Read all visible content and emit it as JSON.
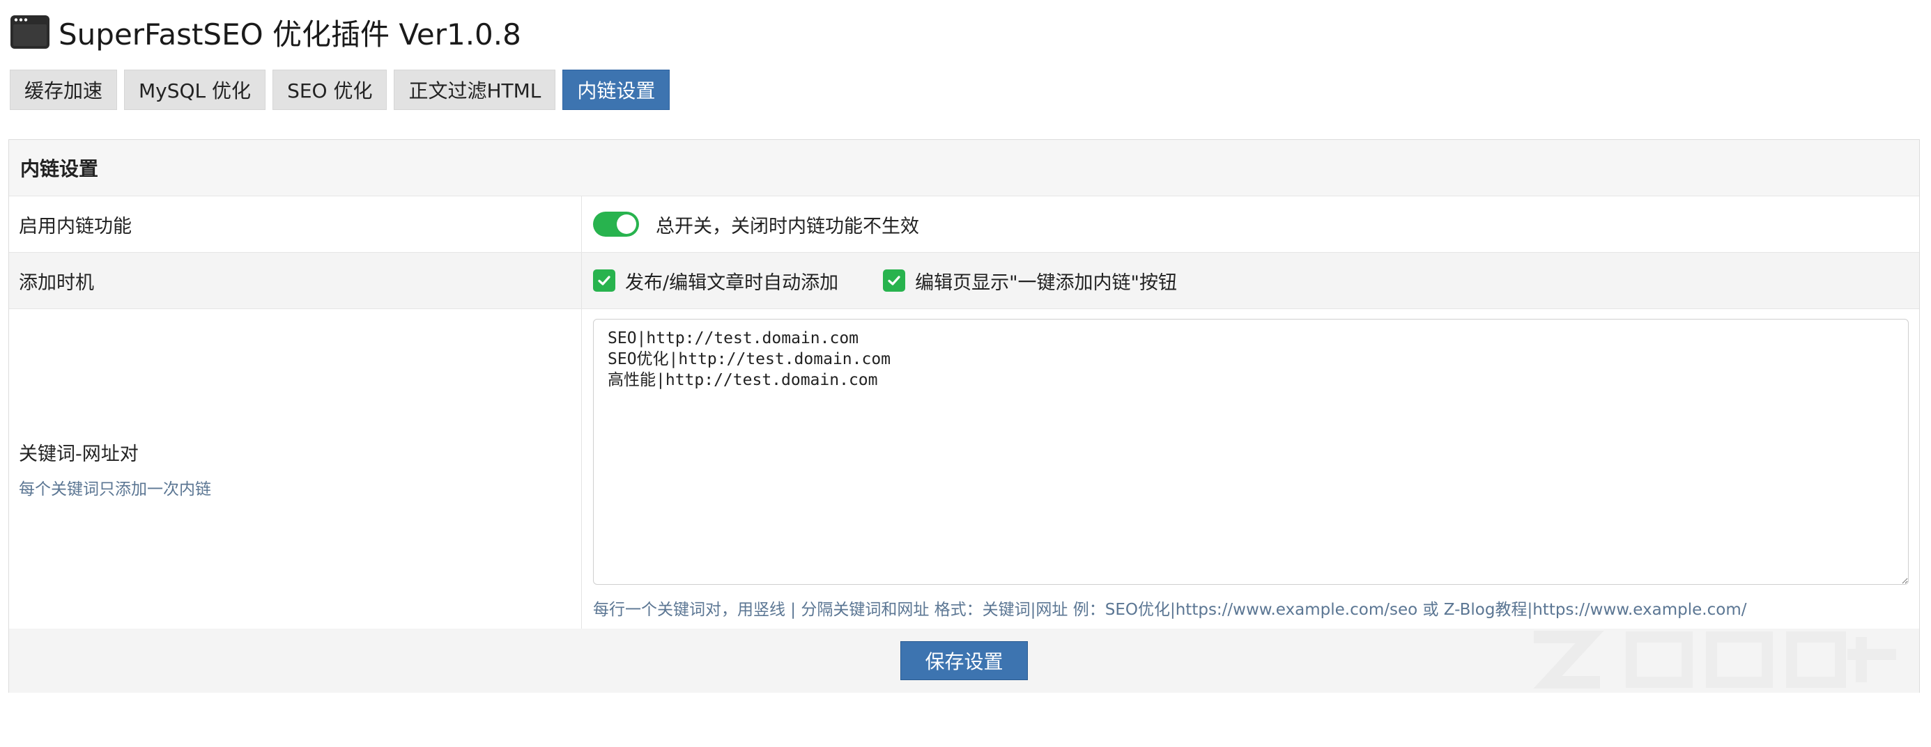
{
  "header": {
    "title": "SuperFastSEO 优化插件 Ver1.0.8",
    "icon": "app-window-icon"
  },
  "tabs": [
    {
      "label": "缓存加速",
      "active": false
    },
    {
      "label": "MySQL 优化",
      "active": false
    },
    {
      "label": "SEO 优化",
      "active": false
    },
    {
      "label": "正文过滤HTML",
      "active": false
    },
    {
      "label": "内链设置",
      "active": true
    }
  ],
  "panel": {
    "title": "内链设置",
    "rows": {
      "enable": {
        "label": "启用内链功能",
        "toggle_on": true,
        "description": "总开关，关闭时内链功能不生效"
      },
      "timing": {
        "label": "添加时机",
        "options": [
          {
            "label": "发布/编辑文章时自动添加",
            "checked": true
          },
          {
            "label": "编辑页显示\"一键添加内链\"按钮",
            "checked": true
          }
        ]
      },
      "keywords": {
        "label": "关键词-网址对",
        "sublabel": "每个关键词只添加一次内链",
        "value": "SEO|http://test.domain.com\nSEO优化|http://test.domain.com\n高性能|http://test.domain.com",
        "help": "每行一个关键词对，用竖线 | 分隔关键词和网址 格式：关键词|网址 例：SEO优化|https://www.example.com/seo 或 Z-Blog教程|https://www.example.com/"
      }
    },
    "save_label": "保存设置"
  },
  "colors": {
    "accent": "#3d74b0",
    "toggle_on": "#28b34e",
    "tab_inactive": "#e2e2e2",
    "help_text": "#5b7693"
  }
}
